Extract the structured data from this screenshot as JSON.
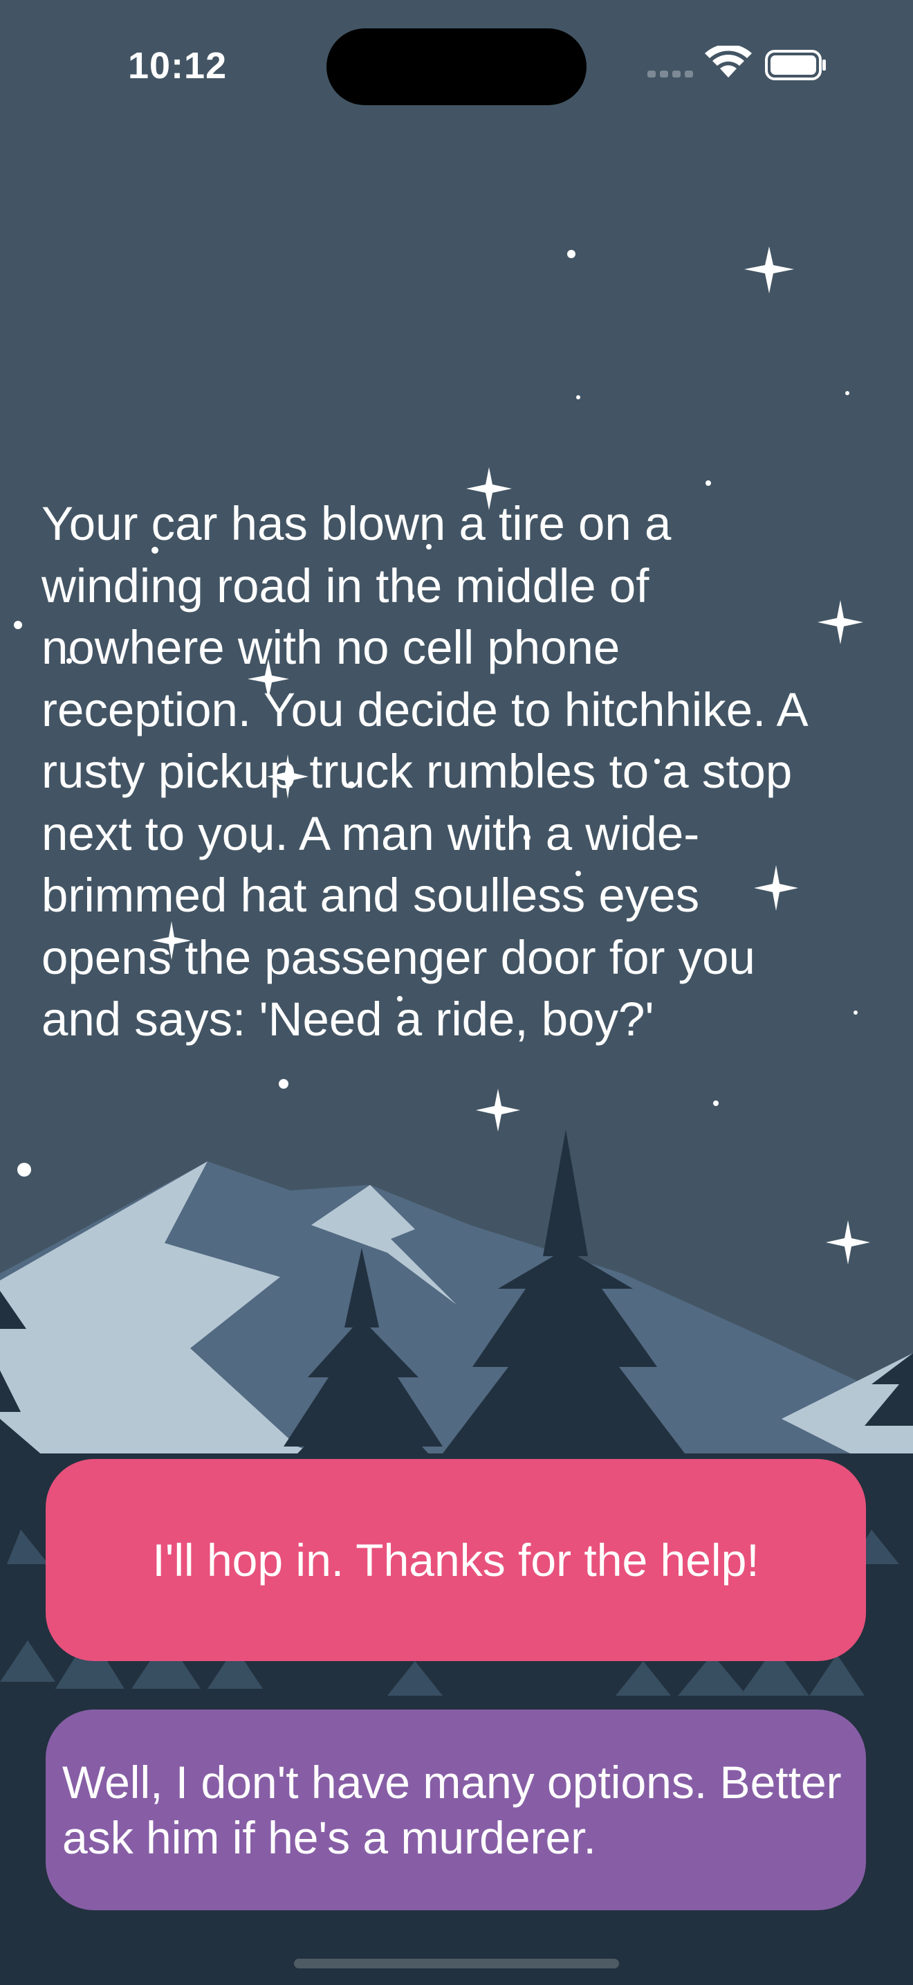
{
  "status_bar": {
    "time": "10:12",
    "icons": [
      "cellular-signal-icon",
      "wifi-icon",
      "battery-icon"
    ]
  },
  "story": {
    "lines": [
      "Your car has blown a tire on a",
      "winding road in the middle of",
      "nowhere with no cell phone",
      "reception. You decide to hitchhike. A",
      "rusty pickup truck rumbles to a stop",
      "next to you. A man with a wide-",
      "brimmed hat and soulless eyes",
      "opens the passenger door for you",
      "and says: 'Need a ride, boy?'"
    ]
  },
  "choices": [
    {
      "label": "I'll hop in. Thanks for the help!",
      "color": "#e8517c"
    },
    {
      "lines": [
        "Well, I don't have many options. Better",
        "ask him if he's a murderer."
      ],
      "color": "#875ea6"
    }
  ],
  "colors": {
    "sky": "#435564",
    "mountain_light": "#b6c7d4",
    "mountain_mid": "#526a82",
    "tree_dark": "#22313f"
  }
}
